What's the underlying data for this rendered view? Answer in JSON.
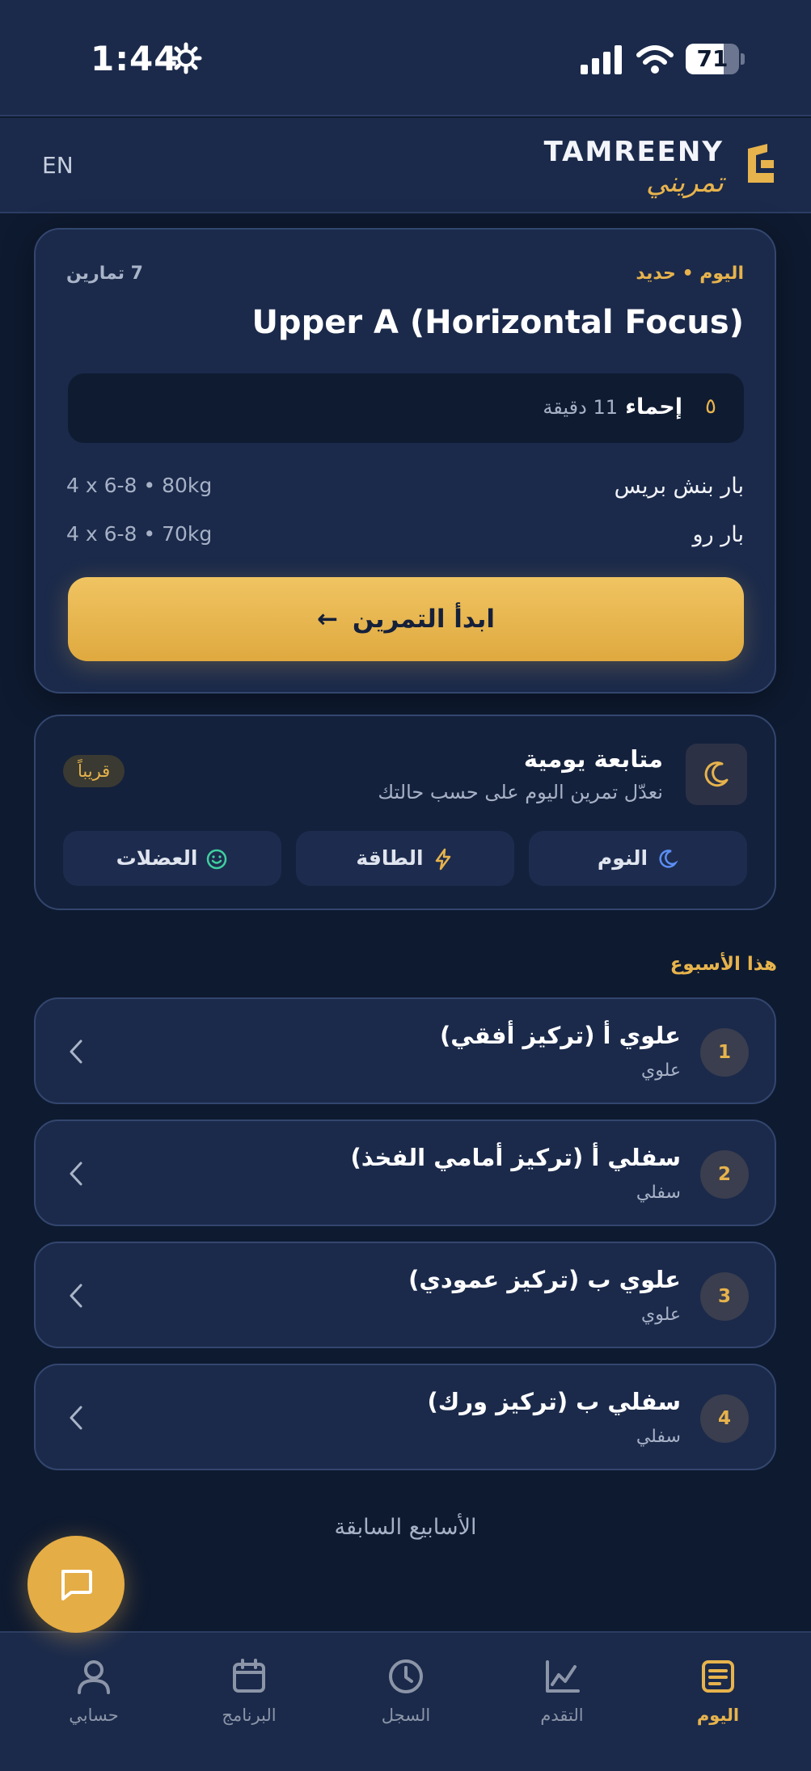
{
  "status_bar": {
    "time": "1:44",
    "battery": "71",
    "battery_level": 0.71
  },
  "header": {
    "lang_toggle": "EN",
    "brand_en": "TAMREENY",
    "brand_ar": "تمريني"
  },
  "today_card": {
    "meta": "اليوم • حديد",
    "exercise_count": "7 تمارين",
    "title": "Upper A (Horizontal Focus)",
    "warmup": {
      "icon": "٥",
      "label": "إحماء",
      "duration": "11 دقيقة"
    },
    "exercises": [
      {
        "name": "بار بنش بريس",
        "detail": "4 x 6-8 • 80kg"
      },
      {
        "name": "بار رو",
        "detail": "4 x 6-8 • 70kg"
      }
    ],
    "start_label": "ابدأ التمرين"
  },
  "checkin": {
    "title": "متابعة يومية",
    "subtitle": "نعدّل تمرين اليوم على حسب حالتك",
    "badge": "قريباً",
    "pills": {
      "sleep": "النوم",
      "energy": "الطاقة",
      "muscles": "العضلات"
    }
  },
  "week": {
    "label": "هذا الأسبوع",
    "items": [
      {
        "num": "1",
        "title": "علوي أ (تركيز أفقي)",
        "sub": "علوي"
      },
      {
        "num": "2",
        "title": "سفلي أ (تركيز أمامي الفخذ)",
        "sub": "سفلي"
      },
      {
        "num": "3",
        "title": "علوي ب (تركيز عمودي)",
        "sub": "علوي"
      },
      {
        "num": "4",
        "title": "سفلي ب (تركيز ورك)",
        "sub": "سفلي"
      }
    ]
  },
  "previous_weeks": "الأسابيع السابقة",
  "tabs": {
    "today": "اليوم",
    "progress": "التقدم",
    "log": "السجل",
    "program": "البرنامج",
    "account": "حسابي"
  },
  "colors": {
    "accent": "#e7b34c",
    "background": "#0e1a30",
    "card": "#1b2a4b"
  }
}
